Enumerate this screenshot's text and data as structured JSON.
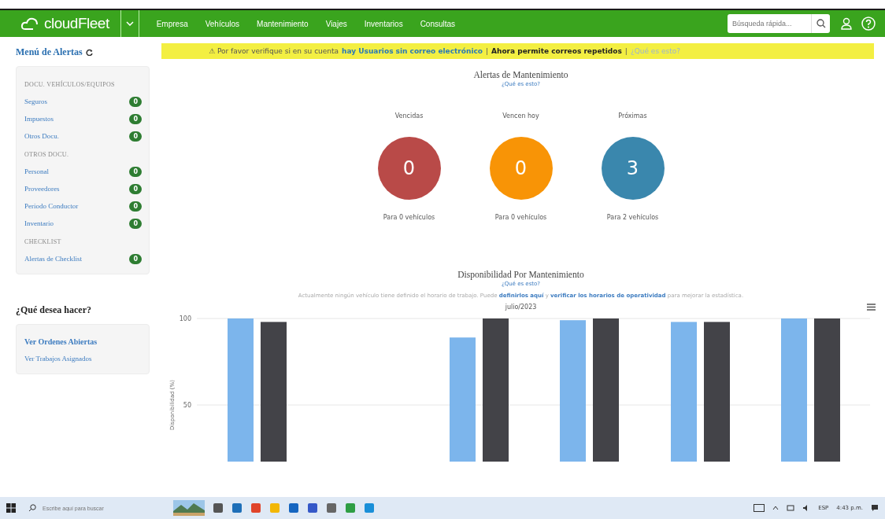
{
  "navbar": {
    "logo": "cloudFleet",
    "menu": [
      "Empresa",
      "Vehículos",
      "Mantenimiento",
      "Viajes",
      "Inventarios",
      "Consultas"
    ],
    "search": {
      "placeholder": "Búsqueda rápida..."
    }
  },
  "sidebar": {
    "title": "Menú de Alertas",
    "groups": [
      {
        "heading": "DOCU. VEHÍCULOS/EQUIPOS",
        "items": [
          {
            "label": "Seguros",
            "count": "0"
          },
          {
            "label": "Impuestos",
            "count": "0"
          },
          {
            "label": "Otros Docu.",
            "count": "0"
          }
        ]
      },
      {
        "heading": "OTROS DOCU.",
        "items": [
          {
            "label": "Personal",
            "count": "0"
          },
          {
            "label": "Proveedores",
            "count": "0"
          },
          {
            "label": "Periodo Conductor",
            "count": "0"
          },
          {
            "label": "Inventario",
            "count": "0"
          }
        ]
      },
      {
        "heading": "CHECKLIST",
        "items": [
          {
            "label": "Alertas de Checklist",
            "count": "0"
          }
        ]
      }
    ],
    "actions_title": "¿Qué desea hacer?",
    "actions": [
      {
        "label": "Ver Ordenes Abiertas",
        "bold": true
      },
      {
        "label": "Ver Trabajos Asignados",
        "bold": false
      }
    ]
  },
  "banner": {
    "text": "⚠ Por favor verifique si en su cuenta",
    "link": "hay Usuarios sin correo electrónico",
    "separator_1": "|",
    "notice": "Ahora permite correos repetidos",
    "separator_2": "|",
    "help": "¿Qué es esto?"
  },
  "maintenance_alerts": {
    "title": "Alertas de Mantenimiento",
    "help": "¿Qué es esto?",
    "cards": [
      {
        "label": "Vencidas",
        "value": "0",
        "footer": "Para 0 vehículos",
        "color": "#b94a48"
      },
      {
        "label": "Vencen hoy",
        "value": "0",
        "footer": "Para 0 vehículos",
        "color": "#f89406"
      },
      {
        "label": "Próximas",
        "value": "3",
        "footer": "Para 2 vehículos",
        "color": "#3a87ad"
      }
    ]
  },
  "availability": {
    "title": "Disponibilidad Por Mantenimiento",
    "help": "¿Qué es esto?",
    "info_before": "Actualmente ningún vehículo tiene definido el horario de trabajo. Puede",
    "info_link_1": "definirlos aquí",
    "info_middle": "y",
    "info_link_2": "verificar los horarios de operatividad",
    "info_after": "para mejorar la estadística.",
    "chart_data": {
      "type": "bar",
      "title": "julio/2023",
      "ylabel": "Disponibilidad (%)",
      "ylim": [
        0,
        100
      ],
      "yticks": [
        50,
        100
      ],
      "series": [
        {
          "color": "#7cb5ec",
          "values": [
            100,
            null,
            89,
            99,
            98,
            100
          ]
        },
        {
          "color": "#434348",
          "values": [
            98,
            null,
            100,
            100,
            98,
            100
          ]
        }
      ]
    }
  },
  "taskbar": {
    "search": {
      "placeholder": "Escribe aquí para buscar"
    },
    "language": "ESP",
    "time": "4:43 p.m."
  }
}
